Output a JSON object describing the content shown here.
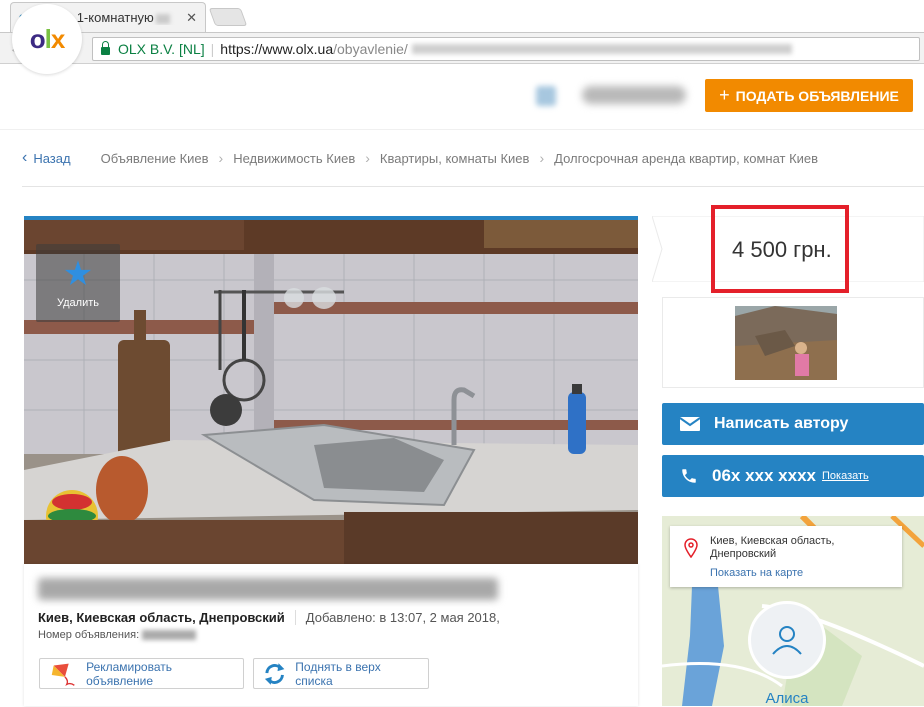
{
  "browser": {
    "tab_title": "Сдам 1-комнатную",
    "tab_close": "✕",
    "tab_favicon": [
      "o",
      "l",
      "x"
    ],
    "nav": {
      "back": "←",
      "forward": "→",
      "reload": "↻"
    },
    "secure_label": "OLX B.V. [NL]",
    "url_host": "https://www.olx.ua",
    "url_path": "/obyavlenie/"
  },
  "header": {
    "logo_letters": [
      "o",
      "l",
      "x"
    ],
    "post_button_plus": "+",
    "post_button_label": "ПОДАТЬ ОБЪЯВЛЕНИЕ"
  },
  "breadcrumbs": {
    "back_arrow": "‹",
    "back_label": "Назад",
    "separator": "›",
    "items": [
      "Объявление Киев",
      "Недвижимость Киев",
      "Квартиры, комнаты Киев",
      "Долгосрочная аренда квартир, комнат Киев"
    ]
  },
  "gallery": {
    "favorite_icon": "★",
    "favorite_label": "Удалить"
  },
  "ad": {
    "location": "Киев, Киевская область, Днепровский",
    "added": "Добавлено: в 13:07, 2 мая 2018,",
    "ad_number_label": "Номер объявления: ",
    "promote_label": "Рекламировать объявление",
    "raise_label": "Поднять в верх списка"
  },
  "sidebar": {
    "price": "4 500 грн.",
    "message_button": "Написать автору",
    "phone": "06х ххх хххх",
    "phone_show": "Показать",
    "map_address": "Киев, Киевская область, Днепровский",
    "map_show": "Показать на карте",
    "seller_name": "Алиса"
  },
  "colors": {
    "accent_blue": "#2583c3",
    "post_orange": "#f28a00",
    "highlight_red": "#e4202a",
    "secure_green": "#0b8043"
  }
}
